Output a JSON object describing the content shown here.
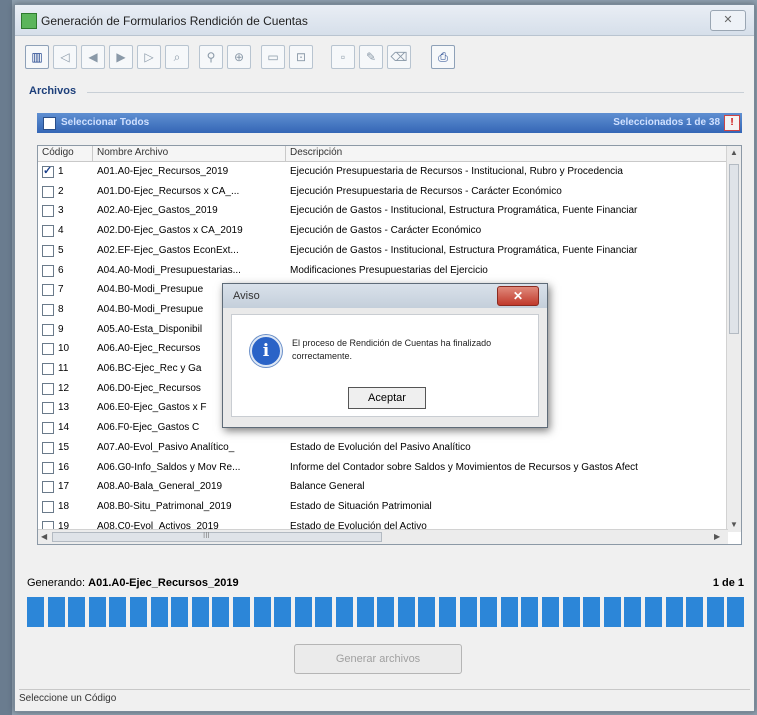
{
  "window": {
    "title": "Generación de Formularios Rendición de Cuentas",
    "close_glyph": "✕"
  },
  "toolbar": {
    "buttons": [
      {
        "name": "list-icon",
        "glyph": "▥",
        "active": true
      },
      {
        "name": "back-icon",
        "glyph": "◁"
      },
      {
        "name": "prev-icon",
        "glyph": "◀"
      },
      {
        "name": "next-icon",
        "glyph": "▶"
      },
      {
        "name": "forward-icon",
        "glyph": "▷"
      },
      {
        "name": "find-icon",
        "glyph": "⌕"
      },
      {
        "name": "binoculars-icon",
        "glyph": "⚲"
      },
      {
        "name": "zoom-icon",
        "glyph": "⊕"
      },
      {
        "name": "save-icon",
        "glyph": "▭"
      },
      {
        "name": "delete-icon",
        "glyph": "⊡"
      },
      {
        "name": "blank-icon",
        "glyph": "▫"
      },
      {
        "name": "pen-icon",
        "glyph": "✎"
      },
      {
        "name": "eraser-icon",
        "glyph": "⌫"
      },
      {
        "name": "print-icon",
        "glyph": "⎙",
        "active": true
      }
    ]
  },
  "files": {
    "group_label": "Archivos",
    "select_all_label": "Seleccionar Todos",
    "selected_count": "Seleccionados 1 de 38",
    "info_glyph": "!",
    "columns": [
      "Código",
      "Nombre Archivo",
      "Descripción"
    ],
    "rows": [
      {
        "code": "1",
        "name": "A01.A0-Ejec_Recursos_2019",
        "desc": "Ejecución Presupuestaria de Recursos - Institucional, Rubro y Procedencia",
        "checked": true
      },
      {
        "code": "2",
        "name": "A01.D0-Ejec_Recursos x CA_...",
        "desc": "Ejecución Presupuestaria de Recursos - Carácter Económico",
        "checked": false
      },
      {
        "code": "3",
        "name": "A02.A0-Ejec_Gastos_2019",
        "desc": "Ejecución de Gastos - Institucional, Estructura Programática, Fuente Financiar",
        "checked": false
      },
      {
        "code": "4",
        "name": "A02.D0-Ejec_Gastos x CA_2019",
        "desc": "Ejecución de Gastos - Carácter Económico",
        "checked": false
      },
      {
        "code": "5",
        "name": "A02.EF-Ejec_Gastos EconExt...",
        "desc": "Ejecución de Gastos - Institucional, Estructura Programática, Fuente Financiar",
        "checked": false
      },
      {
        "code": "6",
        "name": "A04.A0-Modi_Presupuestarias...",
        "desc": "Modificaciones Presupuestarias del Ejercicio",
        "checked": false
      },
      {
        "code": "7",
        "name": "A04.B0-Modi_Presupue",
        "desc": "ercicio (Analítico)",
        "checked": false
      },
      {
        "code": "8",
        "name": "A04.B0-Modi_Presupue",
        "desc": "Ejercicio (Analítico)",
        "checked": false
      },
      {
        "code": "9",
        "name": "A05.A0-Esta_Disponibil",
        "desc": "",
        "checked": false
      },
      {
        "code": "10",
        "name": "A06.A0-Ejec_Recursos",
        "desc": "",
        "checked": false
      },
      {
        "code": "11",
        "name": "A06.BC-Ejec_Rec y Ga",
        "desc": "ados",
        "checked": false
      },
      {
        "code": "12",
        "name": "A06.D0-Ejec_Recursos",
        "desc": "",
        "checked": false
      },
      {
        "code": "13",
        "name": "A06.E0-Ejec_Gastos x F",
        "desc": "o",
        "checked": false
      },
      {
        "code": "14",
        "name": "A06.F0-Ejec_Gastos C",
        "desc": "",
        "checked": false
      },
      {
        "code": "15",
        "name": "A07.A0-Evol_Pasivo Analítico_",
        "desc": "Estado de Evolución del Pasivo Analítico",
        "checked": false
      },
      {
        "code": "16",
        "name": "A06.G0-Info_Saldos y Mov Re...",
        "desc": "Informe del Contador sobre Saldos y Movimientos de Recursos y Gastos Afect",
        "checked": false
      },
      {
        "code": "17",
        "name": "A08.A0-Bala_General_2019",
        "desc": "Balance General",
        "checked": false
      },
      {
        "code": "18",
        "name": "A08.B0-Situ_Patrimonal_2019",
        "desc": "Estado de Situación Patrimonial",
        "checked": false
      },
      {
        "code": "19",
        "name": "A08.C0-Evol_Activos_2019",
        "desc": "Estado de Evolución del Activo",
        "checked": false
      }
    ],
    "hscroll_mark": "III"
  },
  "generation": {
    "label": "Generando:",
    "current_file": "A01.A0-Ejec_Recursos_2019",
    "counter": "1 de 1",
    "progress_percent": 100,
    "button_label": "Generar archivos"
  },
  "status_bar": {
    "text": "Seleccione un Código"
  },
  "dialog": {
    "title": "Aviso",
    "close_glyph": "✕",
    "message": "El proceso de Rendición de Cuentas ha finalizado correctamente.",
    "icon_glyph": "i",
    "ok_label": "Aceptar"
  }
}
